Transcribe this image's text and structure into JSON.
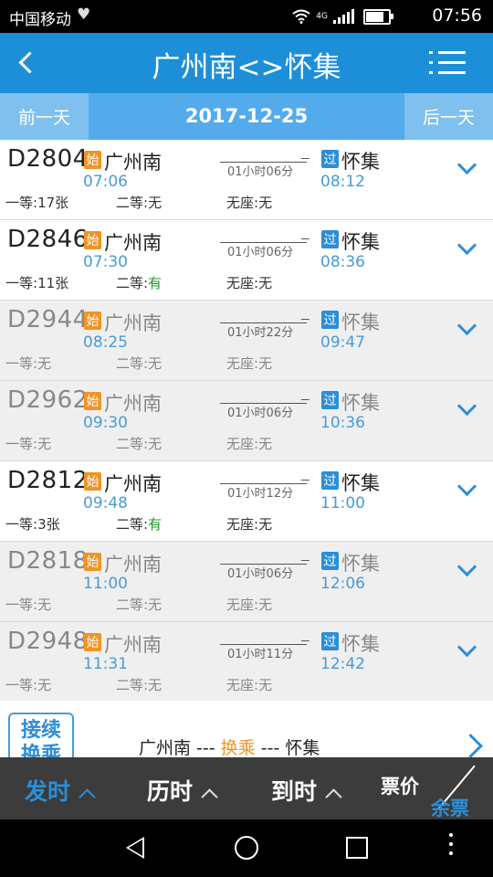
{
  "status_bar": {
    "carrier": "中国移动",
    "network": "4G",
    "time": "07:56",
    "icons": [
      "heart-icon",
      "wifi-icon",
      "signal-icon",
      "battery-icon"
    ]
  },
  "header": {
    "title": "广州南<>怀集",
    "back_icon": "back-arrow-icon",
    "menu_icon": "menu-list-icon"
  },
  "date_bar": {
    "prev_label": "前一天",
    "date": "2017-12-25",
    "next_label": "后一天"
  },
  "trains": [
    {
      "code": "D2804",
      "start_badge": "始",
      "from": "广州南",
      "dep": "07:06",
      "duration": "01小时06分",
      "pass_badge": "过",
      "to": "怀集",
      "arr": "08:12",
      "seat1_label": "一等:",
      "seat1_value": "17张",
      "seat2_label": "二等:",
      "seat2_value": "无",
      "seat3_label": "无座:",
      "seat3_value": "无",
      "greyed": false
    },
    {
      "code": "D2846",
      "start_badge": "始",
      "from": "广州南",
      "dep": "07:30",
      "duration": "01小时06分",
      "pass_badge": "过",
      "to": "怀集",
      "arr": "08:36",
      "seat1_label": "一等:",
      "seat1_value": "11张",
      "seat2_label": "二等:",
      "seat2_value": "有",
      "seat3_label": "无座:",
      "seat3_value": "无",
      "greyed": false
    },
    {
      "code": "D2944",
      "start_badge": "始",
      "from": "广州南",
      "dep": "08:25",
      "duration": "01小时22分",
      "pass_badge": "过",
      "to": "怀集",
      "arr": "09:47",
      "seat1_label": "一等:",
      "seat1_value": "无",
      "seat2_label": "二等:",
      "seat2_value": "无",
      "seat3_label": "无座:",
      "seat3_value": "无",
      "greyed": true
    },
    {
      "code": "D2962",
      "start_badge": "始",
      "from": "广州南",
      "dep": "09:30",
      "duration": "01小时06分",
      "pass_badge": "过",
      "to": "怀集",
      "arr": "10:36",
      "seat1_label": "一等:",
      "seat1_value": "无",
      "seat2_label": "二等:",
      "seat2_value": "无",
      "seat3_label": "无座:",
      "seat3_value": "无",
      "greyed": true
    },
    {
      "code": "D2812",
      "start_badge": "始",
      "from": "广州南",
      "dep": "09:48",
      "duration": "01小时12分",
      "pass_badge": "过",
      "to": "怀集",
      "arr": "11:00",
      "seat1_label": "一等:",
      "seat1_value": "3张",
      "seat2_label": "二等:",
      "seat2_value": "有",
      "seat3_label": "无座:",
      "seat3_value": "无",
      "greyed": false
    },
    {
      "code": "D2818",
      "start_badge": "始",
      "from": "广州南",
      "dep": "11:00",
      "duration": "01小时06分",
      "pass_badge": "过",
      "to": "怀集",
      "arr": "12:06",
      "seat1_label": "一等:",
      "seat1_value": "无",
      "seat2_label": "二等:",
      "seat2_value": "无",
      "seat3_label": "无座:",
      "seat3_value": "无",
      "greyed": true
    },
    {
      "code": "D2948",
      "start_badge": "始",
      "from": "广州南",
      "dep": "11:31",
      "duration": "01小时11分",
      "pass_badge": "过",
      "to": "怀集",
      "arr": "12:42",
      "seat1_label": "一等:",
      "seat1_value": "无",
      "seat2_label": "二等:",
      "seat2_value": "无",
      "seat3_label": "无座:",
      "seat3_value": "无",
      "greyed": true
    }
  ],
  "transfer": {
    "badge_line1": "接续",
    "badge_line2": "换乘",
    "route_from": "广州南",
    "route_sep1": " --- ",
    "route_mid": "换乘",
    "route_sep2": " --- ",
    "route_to": "怀集"
  },
  "sort_bar": {
    "depart_label": "发时",
    "duration_label": "历时",
    "arrive_label": "到时",
    "price_label": "票价",
    "remaining_label": "余票",
    "active": "depart"
  },
  "colors": {
    "header_bg": "#1d8fd8",
    "date_bar_bg": "#53abec",
    "accent_blue": "#2c8ed9",
    "start_badge": "#f29322",
    "available_green": "#1c9a2a",
    "sort_bar_bg": "#3c3c3c"
  }
}
